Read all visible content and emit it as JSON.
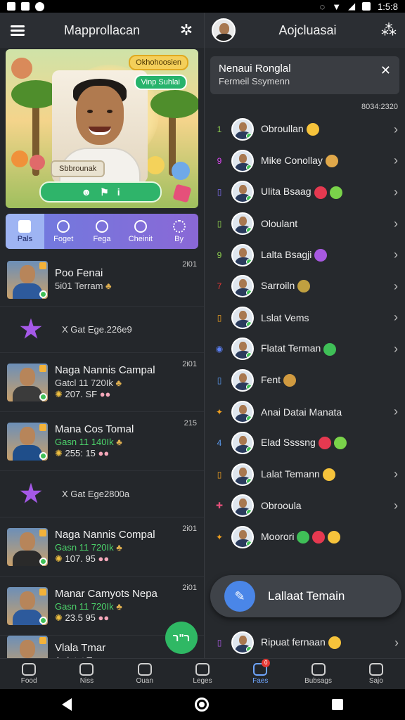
{
  "status": {
    "time": "1:5:8"
  },
  "left": {
    "title": "Mapprollacan",
    "banner": {
      "chip_top": "Okhohoosien",
      "chip_mid": "Vinp Suhlai",
      "name_tag": "Sbbrounak"
    },
    "tabs": [
      "Pals",
      "Foget",
      "Fega",
      "Cheinit",
      "By"
    ],
    "rows": [
      {
        "type": "person",
        "name": "Poo Fenai",
        "sub": "5i01 Terram",
        "sub_green": false,
        "stat": "",
        "time": "2i01"
      },
      {
        "type": "ghost",
        "text": "X  Gat Ege.226e9"
      },
      {
        "type": "person",
        "name": "Naga Nannis Campal",
        "sub": "Gatcl 11 720Ik",
        "sub_green": false,
        "stat": "207. SF",
        "time": "2i01"
      },
      {
        "type": "person",
        "name": "Mana Cos Tomal",
        "sub": "Gasn 11 140Ik",
        "sub_green": true,
        "stat": "255: 15",
        "time": "215"
      },
      {
        "type": "ghost",
        "text": "X  Gat Ege2800a"
      },
      {
        "type": "person",
        "name": "Naga Nannis Compal",
        "sub": "Gasn 11 720Ik",
        "sub_green": true,
        "stat": "107. 95",
        "time": "2i01"
      },
      {
        "type": "person",
        "name": "Manar Camyots Nepa",
        "sub": "Gasn 11 720Ik",
        "sub_green": true,
        "stat": "23.5 95",
        "time": "2i01"
      },
      {
        "type": "person",
        "name": "Vlala Tmar",
        "sub": "Ardetat Tenaan",
        "sub_green": false,
        "stat": "",
        "time": ""
      }
    ],
    "fab_label": "ר\"ר"
  },
  "right": {
    "title": "Aojcluasai",
    "notice": {
      "title": "Nenaui Ronglal",
      "sub": "Fermeil Ssymenn"
    },
    "counter": "8034:2320",
    "items": [
      {
        "num": "1",
        "num_color": "#8fd14f",
        "name": "Obroullan",
        "emojis": [
          "#f6c33b"
        ],
        "chev": true
      },
      {
        "num": "9",
        "num_color": "#d946ef",
        "name": "Mike Conollay",
        "emojis": [
          "#e0a84a"
        ],
        "chev": true
      },
      {
        "num": "▯",
        "num_color": "#7c6cf0",
        "name": "Ulita Bsaag",
        "emojis": [
          "#e53950",
          "#7ad34a"
        ],
        "chev": true
      },
      {
        "num": "▯",
        "num_color": "#8fd14f",
        "name": "Oloulant",
        "emojis": [],
        "chev": true
      },
      {
        "num": "9",
        "num_color": "#8fd14f",
        "name": "Lalta Bsagji",
        "emojis": [
          "#a759e0"
        ],
        "chev": true
      },
      {
        "num": "7",
        "num_color": "#e53935",
        "name": "Sarroiln",
        "emojis": [
          "#c0a040"
        ],
        "chev": true
      },
      {
        "num": "▯",
        "num_color": "#f0a020",
        "name": "Lslat Vems",
        "emojis": [],
        "chev": true
      },
      {
        "num": "◉",
        "num_color": "#5a7ef0",
        "name": "Flatat Terman",
        "emojis": [
          "#3fbf57"
        ],
        "chev": true
      },
      {
        "num": "▯",
        "num_color": "#5a9af0",
        "name": "Fent",
        "emojis": [
          "#d09a40"
        ],
        "chev": false
      },
      {
        "num": "✦",
        "num_color": "#f0a020",
        "name": "Anai Datai Manata",
        "emojis": [],
        "chev": true
      },
      {
        "num": "4",
        "num_color": "#5a9af0",
        "name": "Elad Ssssng",
        "emojis": [
          "#e53950",
          "#7ad34a"
        ],
        "chev": false
      },
      {
        "num": "▯",
        "num_color": "#f0a020",
        "name": "Lalat Temann",
        "emojis": [
          "#f6c33b"
        ],
        "chev": true
      },
      {
        "num": "✚",
        "num_color": "#e5507a",
        "name": "Obrooula",
        "emojis": [],
        "chev": true
      },
      {
        "num": "✦",
        "num_color": "#f0a020",
        "name": "Moorori",
        "emojis": [
          "#3fbf57",
          "#e53950",
          "#f6c33b"
        ],
        "chev": false
      }
    ],
    "pill_label": "Lallaat Temain",
    "last_item": {
      "num": "▯",
      "num_color": "#a759e0",
      "name": "Ripuat fernaan",
      "emojis": [
        "#f6c33b"
      ]
    }
  },
  "bottom_nav": [
    {
      "label": "Food",
      "active": false,
      "badge": ""
    },
    {
      "label": "Niss",
      "active": false,
      "badge": ""
    },
    {
      "label": "Ouan",
      "active": false,
      "badge": ""
    },
    {
      "label": "Leges",
      "active": false,
      "badge": ""
    },
    {
      "label": "Faes",
      "active": true,
      "badge": "0"
    },
    {
      "label": "Bubsags",
      "active": false,
      "badge": ""
    },
    {
      "label": "Sajo",
      "active": false,
      "badge": ""
    }
  ]
}
